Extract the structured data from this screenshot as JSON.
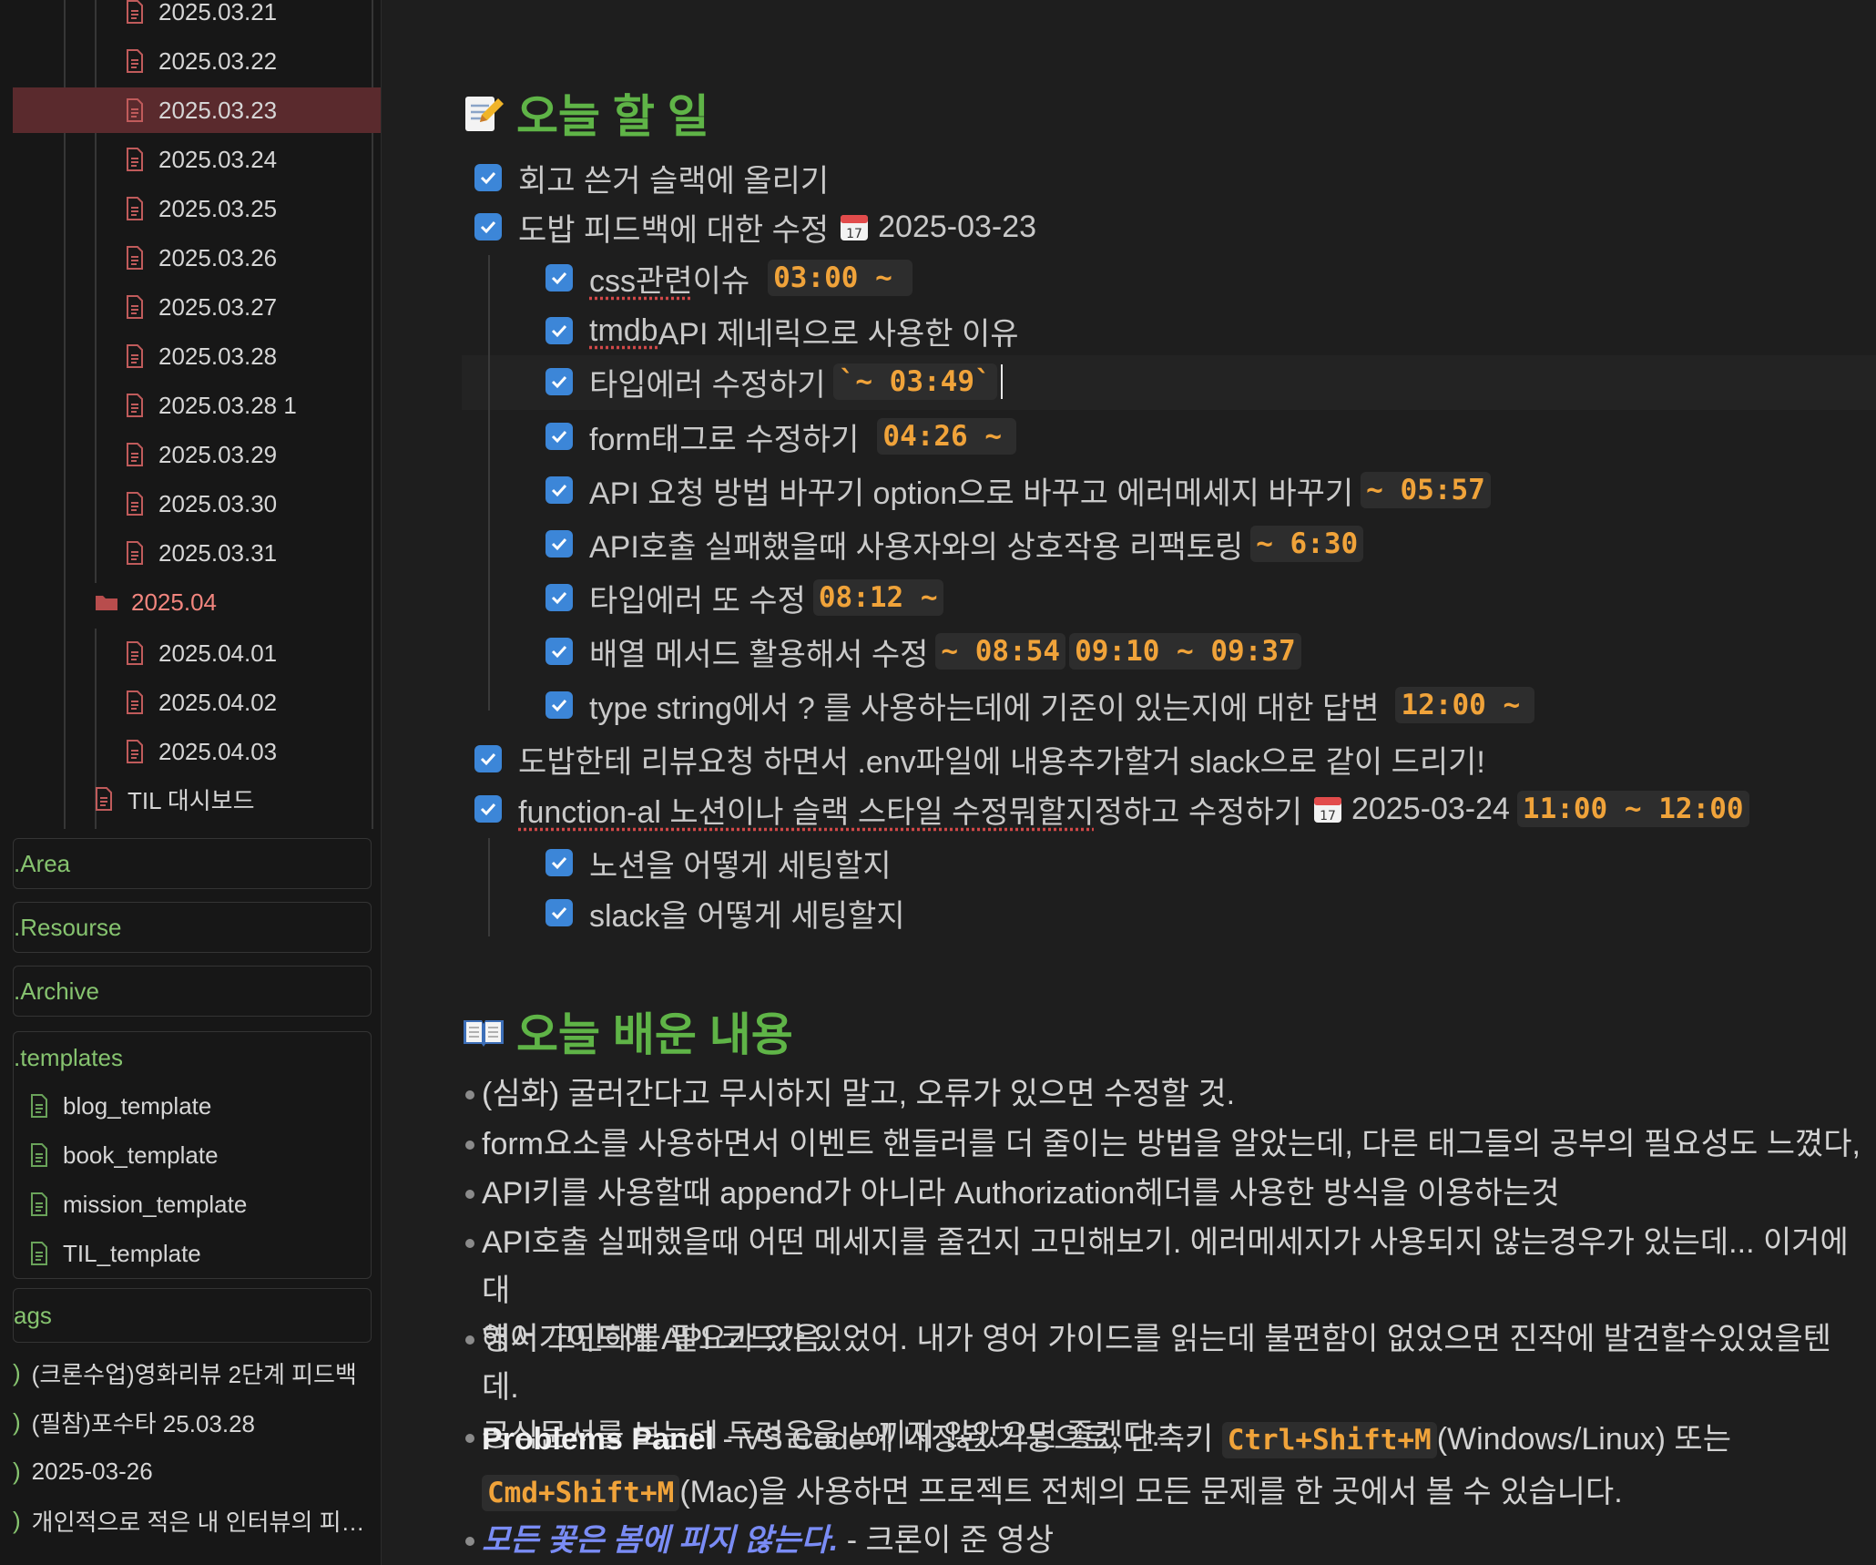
{
  "sidebar": {
    "files_2503": [
      "2025.03.21",
      "2025.03.22",
      "2025.03.23",
      "2025.03.24",
      "2025.03.25",
      "2025.03.26",
      "2025.03.27",
      "2025.03.28",
      "2025.03.28 1",
      "2025.03.29",
      "2025.03.30",
      "2025.03.31"
    ],
    "active_file": "2025.03.23",
    "folder_2504": "2025.04",
    "files_2504": [
      "2025.04.01",
      "2025.04.02",
      "2025.04.03"
    ],
    "dashboard": "TIL 대시보드",
    "sections": [
      ".Area",
      ".Resourse",
      ".Archive"
    ],
    "templates_title": ".templates",
    "templates": [
      "blog_template",
      "book_template",
      "mission_template",
      "TIL_template"
    ],
    "tags_title": "ags",
    "tags": [
      "(크론수업)영화리뷰 2단계 피드백",
      "(필참)포수타 25.03.28",
      "2025-03-26",
      "개인적으로 적은 내 인터뷰의 피…"
    ]
  },
  "main": {
    "todo_heading": "오늘 할 일",
    "todo_emoji": "memo-icon",
    "tasks": [
      {
        "text": "회고 쓴거 슬랙에 올리기"
      },
      {
        "text": "도밥 피드백에 대한 수정",
        "date": "2025-03-23"
      },
      {
        "text_u": "css관련",
        "text": " 이슈",
        "code": "03:00 ~"
      },
      {
        "text_u": "tmdb",
        "text": " API 제네릭으로 사용한 이유"
      },
      {
        "text": "타입에러 수정하기",
        "code": "`~ 03:49`"
      },
      {
        "text": "form태그로 수정하기",
        "code": "04:26 ~"
      },
      {
        "text": "API 요청 방법 바꾸기 option으로 바꾸고 에러메세지 바꾸기",
        "code": "~ 05:57"
      },
      {
        "text": "API호출 실패했을때 사용자와의 상호작용 리팩토링",
        "code": "~ 6:30"
      },
      {
        "text": "타입에러 또 수정",
        "code": "08:12 ~"
      },
      {
        "text": "배열 메서드 활용해서 수정",
        "code": "~ 08:54",
        "code2": "09:10 ~ 09:37"
      },
      {
        "text": "type string에서 ? 를 사용하는데에 기준이 있는지에 대한 답변",
        "code": "12:00 ~"
      },
      {
        "text": "도밥한테 리뷰요청 하면서 .env파일에 내용추가할거 slack으로 같이 드리기!"
      },
      {
        "text_u": "function-al 노션이나 슬랙 스타일 수정뭐할지",
        "text": " 정하고 수정하기",
        "date": "2025-03-24",
        "code": "11:00 ~ 12:00"
      },
      {
        "text": "노션을 어떻게 세팅할지"
      },
      {
        "text": "slack을 어떻게 세팅할지"
      }
    ],
    "learned_heading": "오늘 배운 내용",
    "learned_emoji": "open-book-icon",
    "bullets": {
      "b1": "(심화) 굴러간다고 무시하지 말고, 오류가 있으면 수정할 것.",
      "b2": "form요소를 사용하면서 이벤트 핸들러를 더 줄이는 방법을 알았는데, 다른 태그들의 공부의 필요성도 느꼈다,",
      "b3": "API키를 사용할때 append가 아니라 Authorization헤더를 사용한 방식을 이용하는것",
      "b4a": "API호출 실패했을때 어떤 메세지를 줄건지 고민해보기. 에러메세지가 사용되지 않는경우가 있는데... 이거에 대",
      "b4b": "해서 고민해볼 필요가 있음.",
      "b5a": "영어가이드에 API 코드가 있었어. 내가 영어 가이드를 읽는데 불편함이 없었으면 진작에 발견할수있었을텐데.",
      "b5b": "공식문서를 보는데 두려움을 느끼지 않았으면 좋겠다.",
      "b6_bold": "Problems Panel",
      "b6_text1": " - VS Code에 내장된 기능으로, 단축키 ",
      "b6_code1": "Ctrl+Shift+M",
      "b6_text2": "(Windows/Linux) 또는",
      "b6_code2": "Cmd+Shift+M",
      "b6_text3": "(Mac)을 사용하면 프로젝트 전체의 모든 문제를 한 곳에서 볼 수 있습니다.",
      "b7_link": "모든 꽃은 봄에 피지 않는다.",
      "b7_text": " - 크론이 준 영상"
    }
  }
}
